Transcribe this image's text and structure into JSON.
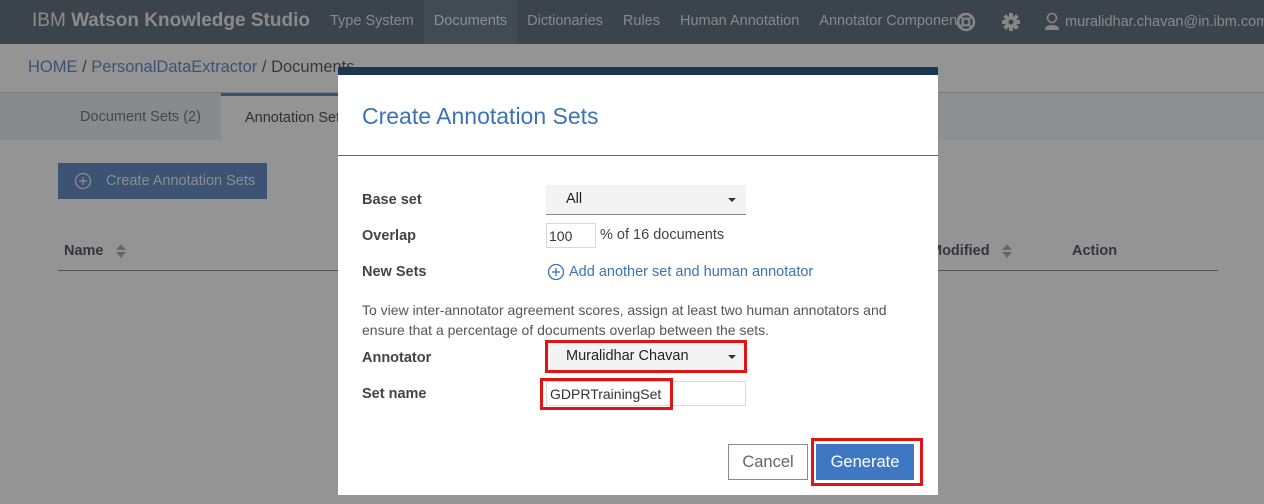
{
  "app": {
    "brand_prefix": "IBM",
    "brand_name": "Watson Knowledge Studio"
  },
  "nav": {
    "items": [
      {
        "label": "Type System",
        "active": false
      },
      {
        "label": "Documents",
        "active": true
      },
      {
        "label": "Dictionaries",
        "active": false
      },
      {
        "label": "Rules",
        "active": false
      },
      {
        "label": "Human Annotation",
        "active": false
      },
      {
        "label": "Annotator Component",
        "active": false
      }
    ],
    "icons": [
      "help-lifebuoy-icon",
      "settings-gear-icon",
      "user-icon"
    ],
    "user_email": "muralidhar.chavan@in.ibm.com"
  },
  "breadcrumb": {
    "home": "HOME",
    "sep": "/",
    "project": "PersonalDataExtractor",
    "current": "Documents"
  },
  "tabs": [
    {
      "label": "Document Sets (2)",
      "active": false
    },
    {
      "label": "Annotation Sets",
      "active": true
    }
  ],
  "page": {
    "create_button": "Create Annotation Sets",
    "table_headers": {
      "name": "Name",
      "modified": "Modified",
      "action": "Action"
    }
  },
  "modal": {
    "title": "Create Annotation Sets",
    "base_set": {
      "label": "Base set",
      "value": "All"
    },
    "overlap": {
      "label": "Overlap",
      "value": "100",
      "suffix": "% of 16 documents"
    },
    "new_sets": {
      "label": "New Sets",
      "add_link": "Add another set and human annotator"
    },
    "help_text": "To view inter-annotator agreement scores, assign at least two human annotators and ensure that a percentage of documents overlap between the sets.",
    "annotator": {
      "label": "Annotator",
      "value": "Muralidhar Chavan"
    },
    "set_name": {
      "label": "Set name",
      "value": "GDPRTrainingSet"
    },
    "cancel": "Cancel",
    "generate": "Generate"
  },
  "colors": {
    "nav_bg": "#3b4f62",
    "accent": "#3e78c2",
    "modal_top_bar": "#1c3850",
    "highlight": "#e01414"
  }
}
